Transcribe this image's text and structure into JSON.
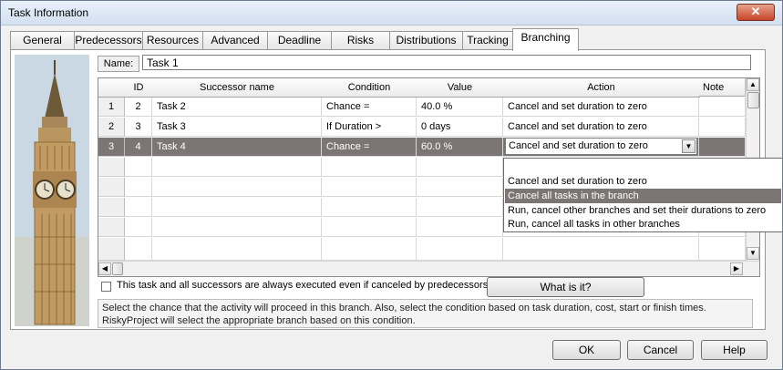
{
  "window": {
    "title": "Task Information",
    "close_glyph": "✕"
  },
  "tabs": [
    {
      "label": "General"
    },
    {
      "label": "Predecessors"
    },
    {
      "label": "Resources"
    },
    {
      "label": "Advanced"
    },
    {
      "label": "Deadline"
    },
    {
      "label": "Risks"
    },
    {
      "label": "Distributions"
    },
    {
      "label": "Tracking"
    },
    {
      "label": "Branching",
      "active": true
    }
  ],
  "name_field": {
    "label": "Name:",
    "value": "Task 1"
  },
  "grid": {
    "columns": [
      "ID",
      "Successor name",
      "Condition",
      "Value",
      "Action",
      "Note"
    ],
    "rows": [
      {
        "num": "1",
        "id": "2",
        "successor": "Task 2",
        "condition": "Chance =",
        "value": "40.0 %",
        "action": "Cancel and set duration to zero",
        "note": ""
      },
      {
        "num": "2",
        "id": "3",
        "successor": "Task 3",
        "condition": "If Duration >",
        "value": "0 days",
        "action": "Cancel and set duration to zero",
        "note": ""
      },
      {
        "num": "3",
        "id": "4",
        "successor": "Task 4",
        "condition": "Chance =",
        "value": "60.0 %",
        "action": "Cancel and set duration to zero",
        "note": "",
        "selected": true
      }
    ]
  },
  "action_dropdown": {
    "options": [
      "Cancel and set duration to zero",
      "Cancel all tasks in the branch",
      "Run, cancel other branches and set their durations to zero",
      "Run, cancel all tasks in other branches"
    ],
    "highlighted_index": 1
  },
  "always_execute_checkbox": {
    "label": "This task and all successors are always executed even if canceled by predecessors",
    "checked": false
  },
  "what_is_it_button": "What is it?",
  "info_text": "Select the chance that the activity will proceed in this branch. Also, select the condition based on task duration, cost, start or finish times. RiskyProject will select the appropriate branch based on this condition.",
  "buttons": {
    "ok": "OK",
    "cancel": "Cancel",
    "help": "Help"
  },
  "colors": {
    "selection": "#7b7573",
    "title_bar": "#d3e0f0",
    "close_button": "#c8452a"
  },
  "icons": {
    "scroll_up": "▲",
    "scroll_down": "▼",
    "scroll_left": "◀",
    "scroll_right": "▶",
    "dropdown_arrow": "▼"
  }
}
